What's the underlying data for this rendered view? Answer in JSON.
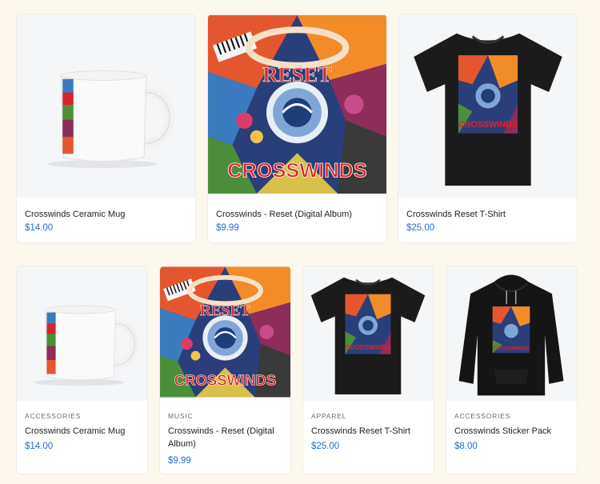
{
  "colors": {
    "background": "#fdf8ee",
    "price": "#1e6fd0",
    "card": "#ffffff",
    "thumb_bg": "#f4f6f8"
  },
  "top_row": [
    {
      "name": "Crosswinds Ceramic Mug",
      "price": "$14.00",
      "image": "mug-image"
    },
    {
      "name": "Crosswinds - Reset (Digital Album)",
      "price": "$9.99",
      "image": "album-cover-image"
    },
    {
      "name": "Crosswinds Reset T-Shirt",
      "price": "$25.00",
      "image": "tshirt-image"
    }
  ],
  "bottom_row": [
    {
      "category": "ACCESSORIES",
      "name": "Crosswinds Ceramic Mug",
      "price": "$14.00",
      "image": "mug-image"
    },
    {
      "category": "MUSIC",
      "name": "Crosswinds - Reset (Digital Album)",
      "price": "$9.99",
      "image": "album-cover-image"
    },
    {
      "category": "APPAREL",
      "name": "Crosswinds Reset T-Shirt",
      "price": "$25.00",
      "image": "tshirt-image"
    },
    {
      "category": "ACCESSORIES",
      "name": "Crosswinds Sticker Pack",
      "price": "$8.00",
      "image": "hoodie-image"
    }
  ],
  "artwork": {
    "title_word": "RESET",
    "band_word": "CROSSWINDS"
  }
}
